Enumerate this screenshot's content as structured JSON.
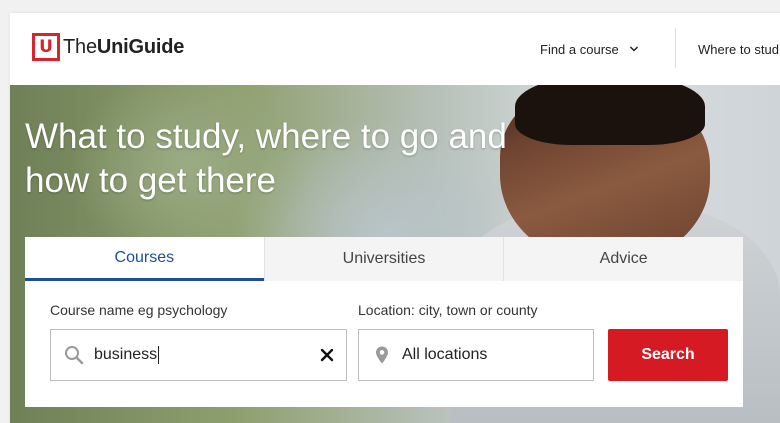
{
  "brand": {
    "mark": "U",
    "name_regular": "The",
    "name_bold": "UniGuide",
    "color": "#d6252e"
  },
  "nav": {
    "find_course": "Find a course",
    "where_to_study": "Where to stud"
  },
  "hero": {
    "line1": "What to study, where to go and",
    "line2": "how to get there"
  },
  "search": {
    "tabs": [
      {
        "label": "Courses",
        "active": true
      },
      {
        "label": "Universities",
        "active": false
      },
      {
        "label": "Advice",
        "active": false
      }
    ],
    "course_label": "Course name eg psychology",
    "course_value": "business",
    "location_label": "Location: city, town or county",
    "location_value": "All locations",
    "button_label": "Search",
    "accent_color": "#1f4d9c",
    "button_color": "#d51a24"
  }
}
